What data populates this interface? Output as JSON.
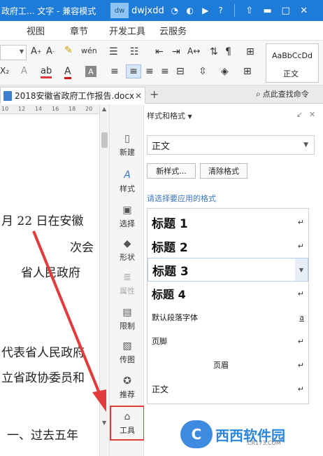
{
  "titlebar": {
    "title": "政府工... 文字 - 兼容模式",
    "badge": "dw",
    "user": "dwjxdd"
  },
  "menu": [
    "视图",
    "章节",
    "开发工具",
    "云服务"
  ],
  "ribbon": {
    "style_preview_sample": "AaBbCcDd",
    "style_preview_name": "正文"
  },
  "tab": {
    "doc_name": "2018安徽省政府工作报告.docx",
    "add": "+",
    "search_label": "点此查找命令"
  },
  "ruler": [
    "10",
    "12",
    "14",
    "16",
    "18",
    "20"
  ],
  "document": {
    "lines": [
      "月 22 日在安徽",
      "次会",
      "省人民政府",
      "代表省人民政府",
      "立省政协委员和",
      "一、过去五年"
    ]
  },
  "sidetools": [
    {
      "label": "新建",
      "icon": "new-icon",
      "glyph": "▯"
    },
    {
      "label": "样式",
      "icon": "style-icon",
      "glyph": "A"
    },
    {
      "label": "选择",
      "icon": "select-icon",
      "glyph": "▣"
    },
    {
      "label": "形状",
      "icon": "shape-icon",
      "glyph": "◆"
    },
    {
      "label": "属性",
      "icon": "property-icon",
      "glyph": "≣",
      "disabled": true
    },
    {
      "label": "限制",
      "icon": "restrict-icon",
      "glyph": "▤"
    },
    {
      "label": "传图",
      "icon": "image-icon",
      "glyph": "▧"
    },
    {
      "label": "推荐",
      "icon": "recommend-icon",
      "glyph": "✪"
    },
    {
      "label": "工具",
      "icon": "toolbox-icon",
      "glyph": "⌂",
      "highlight": true
    }
  ],
  "panel": {
    "title": "样式和格式",
    "current_style": "正文",
    "new_style_btn": "新样式...",
    "clear_format_btn": "清除格式",
    "hint": "请选择要应用的格式",
    "styles": [
      {
        "name": "标题  1",
        "mark": "↵",
        "cls": "h1"
      },
      {
        "name": "标题  2",
        "mark": "↵",
        "cls": "h2"
      },
      {
        "name": "标题  3",
        "mark": "",
        "cls": "h3 selected"
      },
      {
        "name": "标题  4",
        "mark": "↵",
        "cls": "h4"
      },
      {
        "name": "默认段落字体",
        "mark": "a",
        "cls": "small"
      },
      {
        "name": "页脚",
        "mark": "↵",
        "cls": "small"
      },
      {
        "name": "页眉",
        "mark": "↵",
        "cls": "small center"
      },
      {
        "name": "正文",
        "mark": "↵",
        "cls": "small"
      }
    ]
  },
  "watermark": {
    "text": "西西软件园",
    "sub": "CR173.COM",
    "logo_letter": "C"
  },
  "colors": {
    "titlebar": "#1f7bd8",
    "annotation": "#e23b3b",
    "hint": "#3a76c4"
  }
}
